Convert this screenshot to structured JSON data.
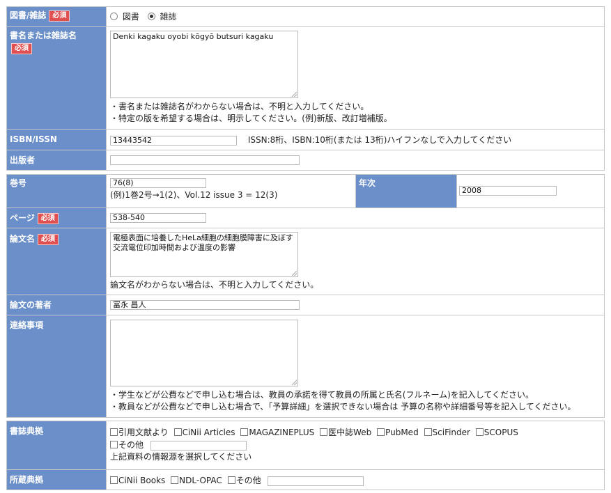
{
  "type_row": {
    "label": "図書/雑誌",
    "required": "必須",
    "options": [
      "図書",
      "雑誌"
    ],
    "selected": "雑誌"
  },
  "title_row": {
    "label": "書名または雑誌名",
    "required": "必須",
    "value": "Denki kagaku oyobi kōgyō butsuri kagaku",
    "notes": [
      "・書名または雑誌名がわからない場合は、不明と入力してください。",
      "・特定の版を希望する場合は、明示してください。(例)新版、改訂増補版。"
    ]
  },
  "isbn_row": {
    "label": "ISBN/ISSN",
    "value": "13443542",
    "hint": "ISSN:8桁、ISBN:10桁(または 13桁)ハイフンなしで入力してください"
  },
  "publisher_row": {
    "label": "出版者",
    "value": ""
  },
  "volume_row": {
    "label": "巻号",
    "value": "76(8)",
    "hint": "(例)1巻2号→1(2)、Vol.12 issue 3 = 12(3)",
    "year_label": "年次",
    "year_value": "2008"
  },
  "page_row": {
    "label": "ページ",
    "required": "必須",
    "value": "538-540"
  },
  "article_row": {
    "label": "論文名",
    "required": "必須",
    "value": "電極表面に培養したHeLa細胞の細胞膜障害に及ぼす交流電位印加時間および温度の影響",
    "note": "論文名がわからない場合は、不明と入力してください。"
  },
  "author_row": {
    "label": "論文の著者",
    "value": "冨永 昌人"
  },
  "contact_row": {
    "label": "連絡事項",
    "value": "",
    "notes": [
      "・学生などが公費などで申し込む場合は、教員の承諾を得て教員の所属と氏名(フルネーム)を記入してください。",
      "・教員などが公費などで申し込む場合で、「予算詳細」を選択できない場合は 予算の名称や詳細番号等を記入してください。"
    ]
  },
  "source_row": {
    "label": "書誌典拠",
    "options": [
      "引用文献より",
      "CiNii Articles",
      "MAGAZINEPLUS",
      "医中誌Web",
      "PubMed",
      "SciFinder",
      "SCOPUS"
    ],
    "other_label": "その他",
    "other_value": "",
    "note": "上記資料の情報源を選択してください"
  },
  "holding_row": {
    "label": "所蔵典拠",
    "options": [
      "CiNii Books",
      "NDL-OPAC"
    ],
    "other_label": "その他",
    "other_value": ""
  }
}
